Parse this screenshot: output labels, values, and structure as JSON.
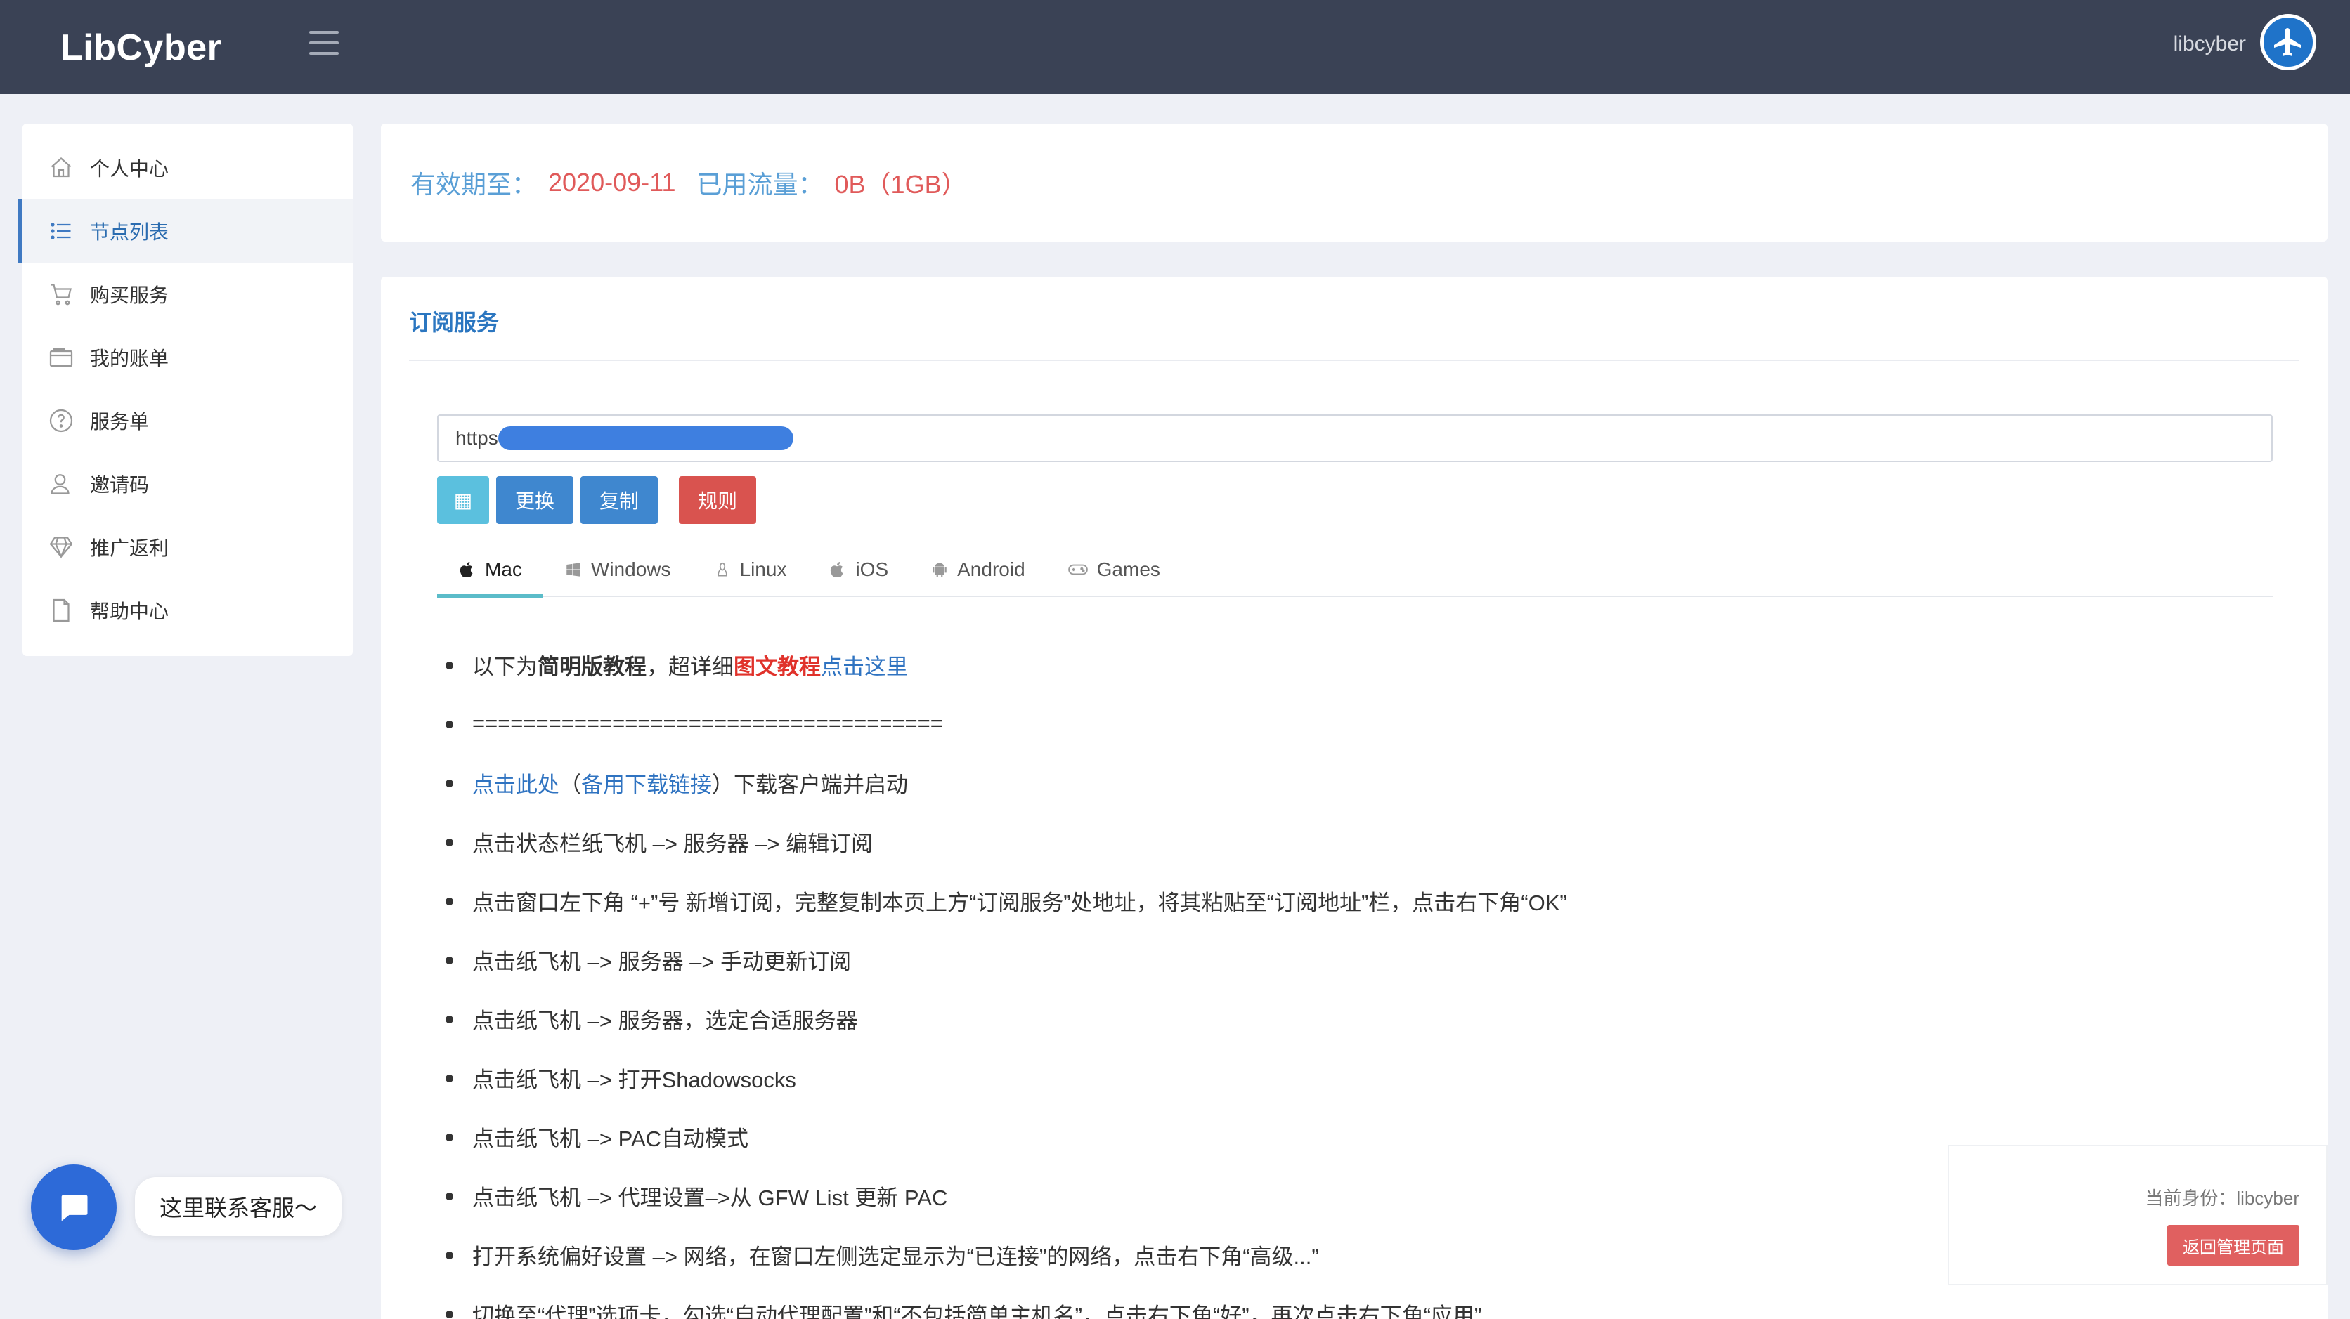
{
  "header": {
    "brand": "LibCyber",
    "username": "libcyber"
  },
  "sidebar": {
    "items": [
      {
        "label": "个人中心",
        "icon": "home-icon"
      },
      {
        "label": "节点列表",
        "icon": "list-icon",
        "active": true
      },
      {
        "label": "购买服务",
        "icon": "cart-icon"
      },
      {
        "label": "我的账单",
        "icon": "wallet-icon"
      },
      {
        "label": "服务单",
        "icon": "question-icon"
      },
      {
        "label": "邀请码",
        "icon": "user-icon"
      },
      {
        "label": "推广返利",
        "icon": "diamond-icon"
      },
      {
        "label": "帮助中心",
        "icon": "document-icon"
      }
    ]
  },
  "info": {
    "expiry_label": "有效期至：",
    "expiry_value": "2020-09-11",
    "traffic_label": "已用流量：",
    "traffic_value": "0B（1GB）"
  },
  "subscription": {
    "title": "订阅服务",
    "url_prefix": "https",
    "buttons": {
      "qr": "▦",
      "change": "更换",
      "copy": "复制",
      "rules": "规则"
    },
    "tabs": [
      "Mac",
      "Windows",
      "Linux",
      "iOS",
      "Android",
      "Games"
    ],
    "active_tab": "Mac"
  },
  "steps": {
    "s1_prefix": "以下为",
    "s1_bold": "简明版教程",
    "s1_mid": "，超详细",
    "s1_red": "图文教程",
    "s1_link": "点击这里",
    "s2": "=====================================",
    "s3_link1": "点击此处",
    "s3_mid1": " （",
    "s3_link2": "备用下载链接",
    "s3_suffix": "）下载客户端并启动",
    "s4": "点击状态栏纸飞机 –> 服务器 –> 编辑订阅",
    "s5": "点击窗口左下角 “+”号 新增订阅，完整复制本页上方“订阅服务”处地址，将其粘贴至“订阅地址”栏，点击右下角“OK”",
    "s6": "点击纸飞机 –> 服务器 –> 手动更新订阅",
    "s7": "点击纸飞机 –> 服务器，选定合适服务器",
    "s8": "点击纸飞机 –> 打开Shadowsocks",
    "s9": "点击纸飞机 –> PAC自动模式",
    "s10": "点击纸飞机 –> 代理设置–>从 GFW List 更新 PAC",
    "s11": "打开系统偏好设置 –> 网络，在窗口左侧选定显示为“已连接”的网络，点击右下角“高级...”",
    "s12": "切换至“代理”选项卡，勾选“自动代理配置”和“不包括简单主机名”，点击右下角“好”，再次点击右下角“应用”"
  },
  "chat": {
    "tip": "这里联系客服～"
  },
  "admin": {
    "identity": "当前身份：libcyber",
    "back_button": "返回管理页面"
  },
  "colors": {
    "header_bg": "#3a4255",
    "accent_blue": "#3f87cf",
    "danger_red": "#d9534f",
    "info_blue": "#5bc0de"
  }
}
